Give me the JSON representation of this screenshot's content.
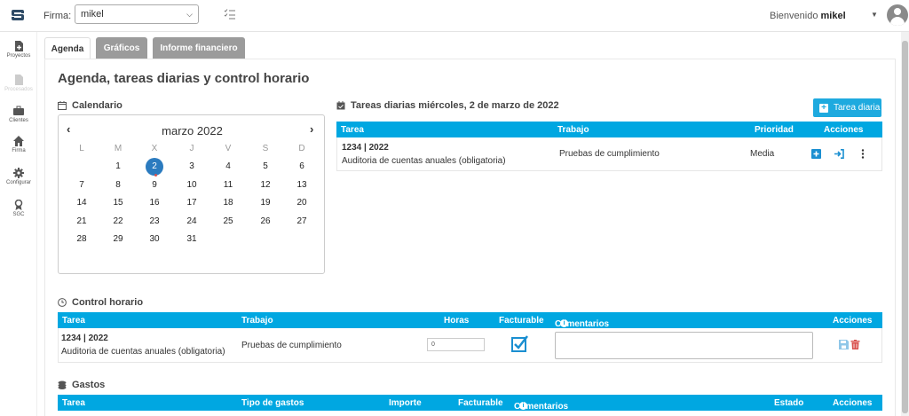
{
  "header": {
    "firma_label": "Firma:",
    "firma_value": "mikel",
    "welcome_prefix": "Bienvenido",
    "welcome_user": "mikel"
  },
  "sidebar": {
    "items": [
      {
        "label": "Proyectos",
        "icon": "file-plus-icon",
        "disabled": false
      },
      {
        "label": "Procesados",
        "icon": "document-icon",
        "disabled": true
      },
      {
        "label": "Clientes",
        "icon": "briefcase-icon",
        "disabled": false
      },
      {
        "label": "Firma",
        "icon": "home-icon",
        "disabled": false
      },
      {
        "label": "Configurar",
        "icon": "gear-icon",
        "disabled": false
      },
      {
        "label": "SGC",
        "icon": "award-icon",
        "disabled": false
      }
    ]
  },
  "tabs": [
    {
      "label": "Agenda",
      "active": true
    },
    {
      "label": "Gráficos",
      "active": false
    },
    {
      "label": "Informe financiero",
      "active": false
    }
  ],
  "page_title": "Agenda, tareas diarias y control horario",
  "calendar": {
    "heading": "Calendario",
    "month": "marzo 2022",
    "prev": "‹",
    "next": "›",
    "dow": [
      "L",
      "M",
      "X",
      "J",
      "V",
      "S",
      "D"
    ],
    "weeks": [
      [
        "",
        "1",
        "2",
        "3",
        "4",
        "5",
        "6"
      ],
      [
        "7",
        "8",
        "9",
        "10",
        "11",
        "12",
        "13"
      ],
      [
        "14",
        "15",
        "16",
        "17",
        "18",
        "19",
        "20"
      ],
      [
        "21",
        "22",
        "23",
        "24",
        "25",
        "26",
        "27"
      ],
      [
        "28",
        "29",
        "30",
        "31",
        "",
        "",
        ""
      ]
    ],
    "today": "2"
  },
  "tareas": {
    "heading": "Tareas diarias miércoles, 2 de marzo de 2022",
    "add_button": "Tarea diaria",
    "columns": [
      "Tarea",
      "Trabajo",
      "Prioridad",
      "Acciones"
    ],
    "rows": [
      {
        "code": "1234 | 2022",
        "desc": "Auditoria de cuentas anuales (obligatoria)",
        "trabajo": "Pruebas de cumplimiento",
        "prioridad": "Media"
      }
    ]
  },
  "control": {
    "heading": "Control horario",
    "columns": [
      "Tarea",
      "Trabajo",
      "Horas",
      "Facturable",
      "Comentarios",
      "Acciones"
    ],
    "rows": [
      {
        "code": "1234 | 2022",
        "desc": "Auditoria de cuentas anuales (obligatoria)",
        "trabajo": "Pruebas de cumplimiento",
        "horas": "0",
        "facturable": true,
        "comentarios": ""
      }
    ]
  },
  "gastos": {
    "heading": "Gastos",
    "columns": [
      "Tarea",
      "Tipo de gastos",
      "Importe",
      "Facturable",
      "Comentarios",
      "Estado",
      "Acciones"
    ]
  },
  "colors": {
    "accent": "#00a7e1",
    "today": "#2b7bbf",
    "delete": "#d9534f"
  }
}
